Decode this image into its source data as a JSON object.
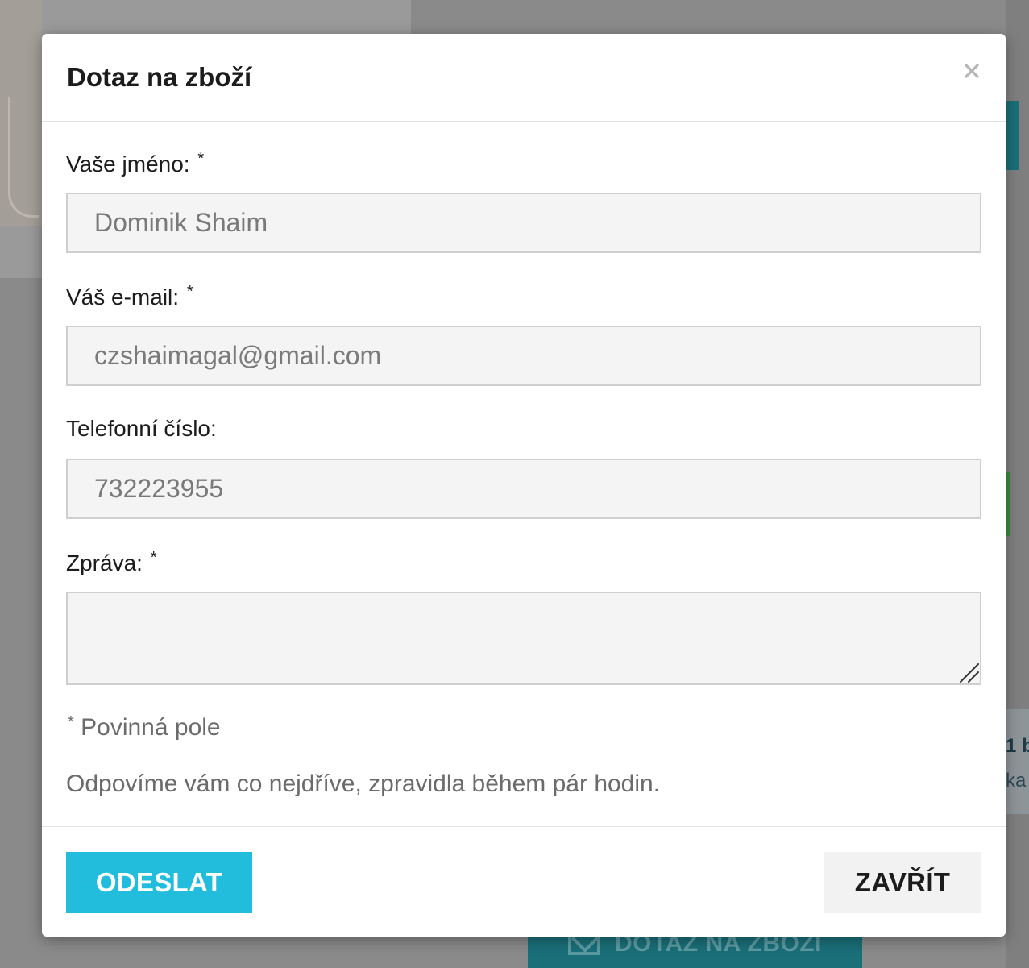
{
  "background": {
    "info_text_1": "1 b",
    "info_text_2": "ka",
    "bottom_button_label": "DOTAZ NA ZBOŽÍ"
  },
  "modal": {
    "title": "Dotaz na zboží",
    "close_icon": "close-icon",
    "fields": {
      "name": {
        "label": "Vaše jméno:",
        "required_mark": "*",
        "value": "Dominik Shaim"
      },
      "email": {
        "label": "Váš e-mail:",
        "required_mark": "*",
        "value": "czshaimagal@gmail.com"
      },
      "phone": {
        "label": "Telefonní číslo:",
        "value": "732223955"
      },
      "message": {
        "label": "Zpráva:",
        "required_mark": "*",
        "value": ""
      }
    },
    "required_note": {
      "mark": "*",
      "text": "Povinná pole"
    },
    "info_note": "Odpovíme vám co nejdříve, zpravidla během pár hodin.",
    "footer": {
      "submit_label": "ODESLAT",
      "close_label": "ZAVŘÍT"
    }
  },
  "colors": {
    "accent": "#22bcdc",
    "overlay": "#8a8a8a",
    "input_bg": "#f4f4f4"
  }
}
